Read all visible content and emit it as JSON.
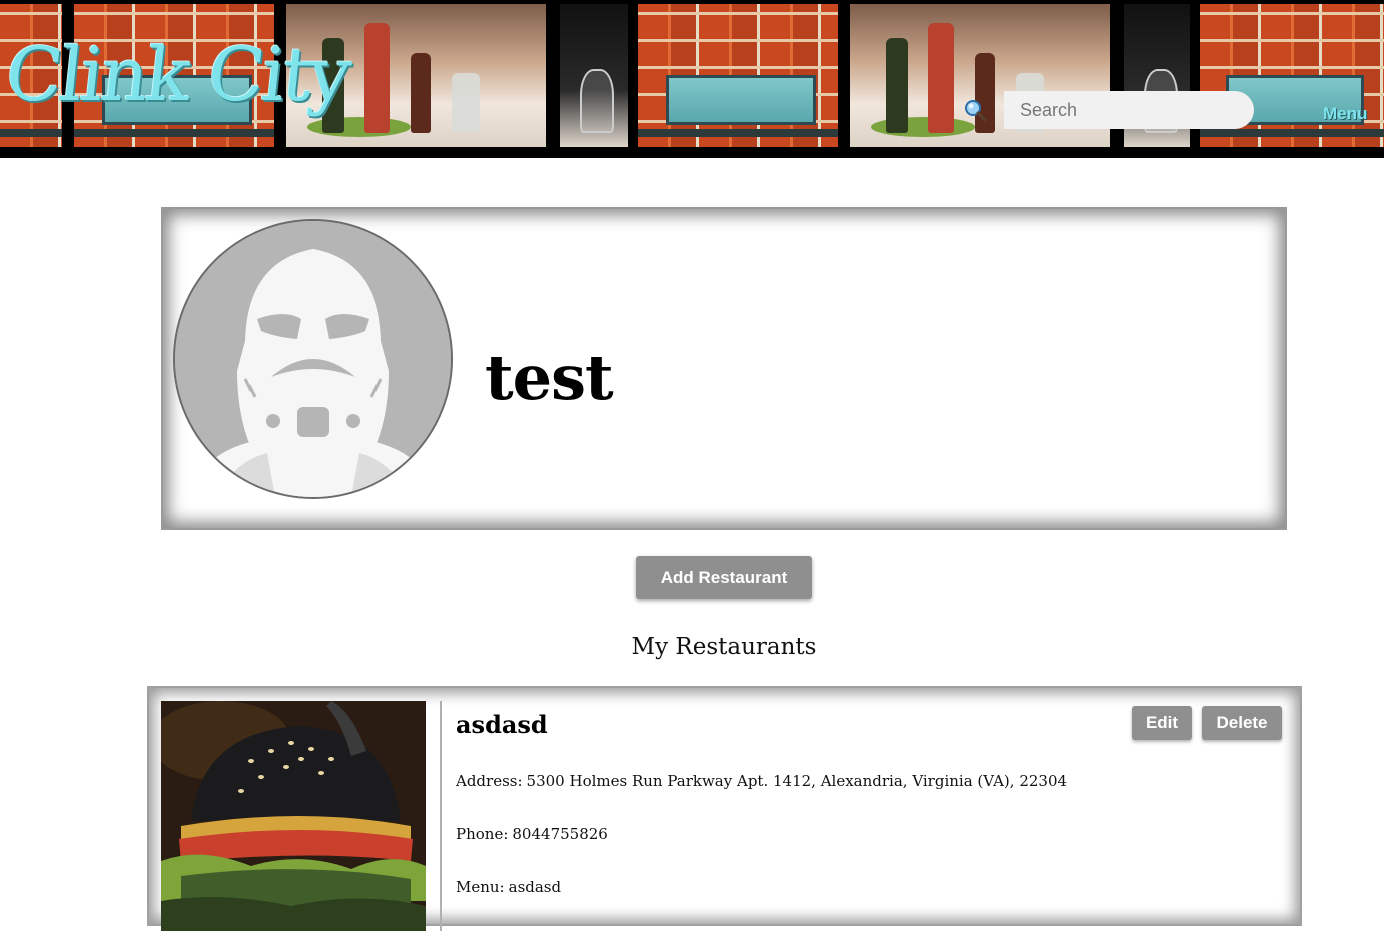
{
  "header": {
    "logo_text": "Clink City",
    "search_placeholder": "Search",
    "menu_label": "Menu"
  },
  "profile": {
    "username": "test"
  },
  "actions": {
    "add_restaurant_label": "Add Restaurant"
  },
  "restaurants_section": {
    "title": "My Restaurants",
    "items": [
      {
        "name": "asdasd",
        "address_label": "Address:",
        "address": "5300 Holmes Run Parkway Apt. 1412, Alexandria, Virginia (VA), 22304",
        "phone_label": "Phone:",
        "phone": "8044755826",
        "menu_label": "Menu:",
        "menu": "asdasd",
        "edit_label": "Edit",
        "delete_label": "Delete"
      }
    ]
  },
  "colors": {
    "logo": "#7fe3ec",
    "button_bg": "#8f8f8f",
    "button_text": "#ffffff"
  },
  "icons": {
    "search": "search-icon",
    "avatar": "stormtrooper-avatar-icon"
  }
}
